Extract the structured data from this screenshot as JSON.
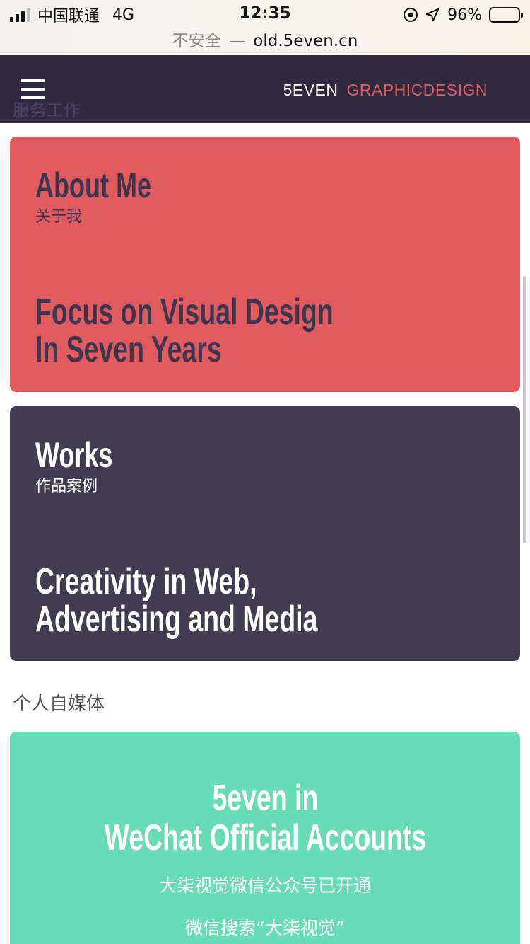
{
  "status_bar": {
    "carrier": "中国联通",
    "network": "4G",
    "time": "12:35",
    "battery": "96%",
    "icons": [
      "signal-icon",
      "rotation-lock-icon",
      "location-icon",
      "battery-icon"
    ]
  },
  "browser": {
    "security_label": "不安全",
    "separator": "—",
    "domain": "old.5even.cn"
  },
  "header": {
    "ghost_text": "服务工作",
    "brand_primary": "5EVEN",
    "brand_secondary": "GRAPHICDESIGN",
    "menu_icon": "hamburger-menu-icon",
    "colors": {
      "background": "#302a40",
      "accent": "#e05a5e"
    }
  },
  "cards": {
    "about": {
      "title": "About Me",
      "subtitle": "关于我",
      "headline_line1": "Focus on Visual Design",
      "headline_line2": "In Seven Years",
      "color": "#e05a5e"
    },
    "works": {
      "title": "Works",
      "subtitle": "作品案例",
      "headline_line1": "Creativity in Web,",
      "headline_line2": "Advertising and Media",
      "color": "#413c52"
    }
  },
  "media_section": {
    "label": "个人自媒体",
    "wechat": {
      "title_line1": "5even in",
      "title_line2": "WeChat Official Accounts",
      "line1": "大柒视觉微信公众号已开通",
      "line2": "微信搜索“大柒视觉”",
      "color": "#68dcb6"
    }
  }
}
